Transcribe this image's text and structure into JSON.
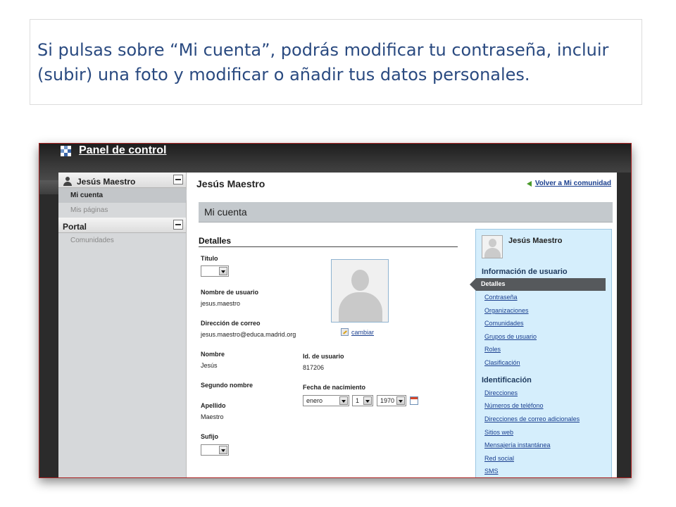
{
  "slide": {
    "caption": "Si pulsas sobre “Mi cuenta”, podrás modificar tu contraseña, incluir (subir) una foto y modificar o añadir tus datos personales."
  },
  "header": {
    "title": "Panel de control"
  },
  "sidebar": {
    "user_section": "Jesús Maestro",
    "user_items": [
      {
        "label": "Mi cuenta",
        "active": true
      },
      {
        "label": "Mis páginas",
        "active": false
      }
    ],
    "portal_section": "Portal",
    "portal_items": [
      {
        "label": "Comunidades",
        "active": false
      }
    ]
  },
  "main": {
    "user_title": "Jesús Maestro",
    "back_link": "Volver a Mi comunidad",
    "section_title": "Mi cuenta",
    "details_title": "Detalles",
    "fields": {
      "titulo_label": "Título",
      "titulo_value": "",
      "username_label": "Nombre de usuario",
      "username_value": "jesus.maestro",
      "email_label": "Dirección de correo",
      "email_value": "jesus.maestro@educa.madrid.org",
      "nombre_label": "Nombre",
      "nombre_value": "Jesús",
      "segundo_label": "Segundo nombre",
      "apellido_label": "Apellido",
      "apellido_value": "Maestro",
      "sufijo_label": "Sufijo",
      "sufijo_value": "",
      "user_id_label": "Id. de usuario",
      "user_id_value": "817206",
      "birth_label": "Fecha de nacimiento",
      "birth_month": "enero",
      "birth_day": "1",
      "birth_year": "1970"
    },
    "photo_change_link": "cambiar"
  },
  "right_panel": {
    "name": "Jesús Maestro",
    "user_info_title": "Información de usuario",
    "active_item": "Detalles",
    "user_info_links": [
      "Contraseña",
      "Organizaciones",
      "Comunidades",
      "Grupos de usuario",
      "Roles",
      "Clasificación"
    ],
    "identification_title": "Identificación",
    "identification_links": [
      "Direcciones",
      "Números de teléfono",
      "Direcciones de correo adicionales",
      "Sitios web",
      "Mensajería instantánea",
      "Red social",
      "SMS"
    ]
  },
  "colors": {
    "caption_text": "#2a4a80",
    "link": "#1a3f8f",
    "right_panel_bg": "#d5eefc",
    "section_bar": "#c4c9cd",
    "active_tab": "#56595c"
  }
}
